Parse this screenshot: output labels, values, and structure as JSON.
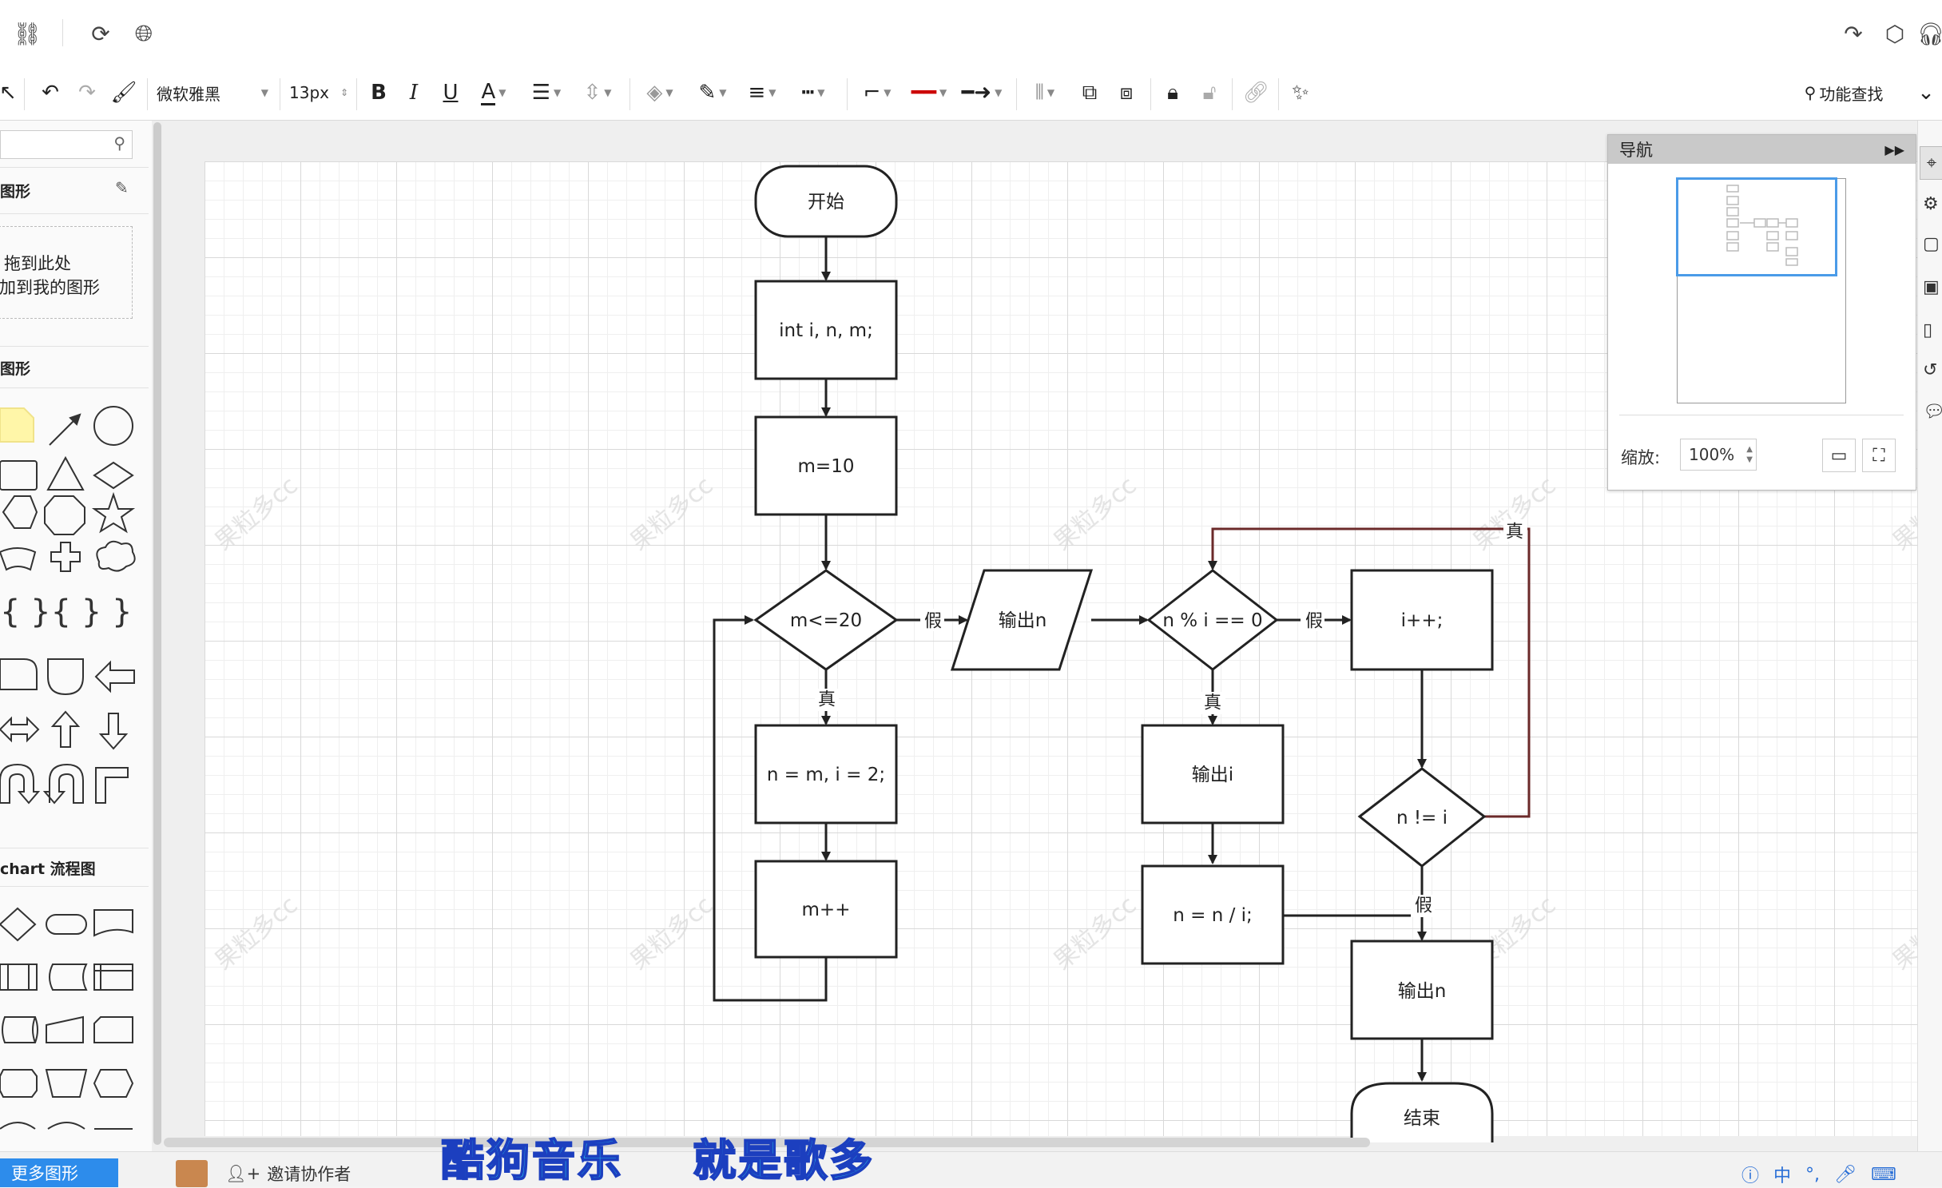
{
  "toolbar": {
    "font_family": "微软雅黑",
    "font_size": "13px",
    "bold": "B",
    "italic": "I",
    "underline": "U",
    "font_color": "A",
    "search_label": "功能查找"
  },
  "sidebar": {
    "section_my_shapes": "图形",
    "drop_hint_line1": "拖到此处",
    "drop_hint_line2": "加到我的图形",
    "section_basic_shapes": "图形",
    "section_flowchart": "chart 流程图"
  },
  "flowchart": {
    "start": "开始",
    "decl": "int i, n, m;",
    "init": "m=10",
    "cond_m": "m<=20",
    "assign": "n = m, i = 2;",
    "inc_m": "m++",
    "output_n_1": "输出n",
    "cond_mod": "n % i == 0",
    "inc_i": "i++;",
    "output_i": "输出i",
    "div": "n = n / i;",
    "cond_neq": "n != i",
    "output_n_2": "输出n",
    "end": "结束",
    "label_true": "真",
    "label_false": "假"
  },
  "navigator": {
    "title": "导航",
    "zoom_label": "缩放:",
    "zoom_value": "100%"
  },
  "bottom": {
    "more_shapes": "更多图形",
    "invite": "邀请协作者",
    "overlay_caption": "酷狗音乐    就是歌多",
    "ime_label": "中"
  },
  "colors": {
    "accent": "#2d8ceb",
    "nav_viewport": "#4a9be8",
    "loop_line": "#6b2a2a",
    "overlay_text": "#26d4f0"
  }
}
